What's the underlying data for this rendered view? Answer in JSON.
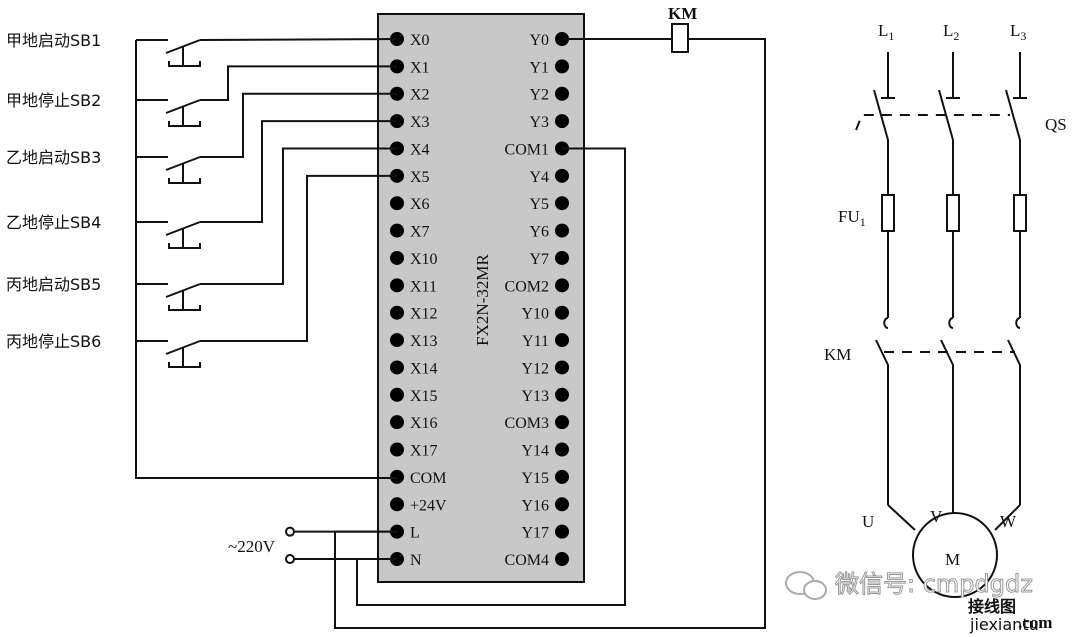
{
  "switches": [
    {
      "label": "甲地启动SB1"
    },
    {
      "label": "甲地停止SB2"
    },
    {
      "label": "乙地启动SB3"
    },
    {
      "label": "乙地停止SB4"
    },
    {
      "label": "丙地启动SB5"
    },
    {
      "label": "丙地停止SB6"
    }
  ],
  "plc": {
    "model": "FX2N-32MR",
    "body_color": "#c8c8c8",
    "left_pins": [
      "X0",
      "X1",
      "X2",
      "X3",
      "X4",
      "X5",
      "X6",
      "X7",
      "X10",
      "X11",
      "X12",
      "X13",
      "X14",
      "X15",
      "X16",
      "X17",
      "COM",
      "+24V",
      "L",
      "N"
    ],
    "right_pins": [
      "Y0",
      "Y1",
      "Y2",
      "Y3",
      "COM1",
      "Y4",
      "Y5",
      "Y6",
      "Y7",
      "COM2",
      "Y10",
      "Y11",
      "Y12",
      "Y13",
      "COM3",
      "Y14",
      "Y15",
      "Y16",
      "Y17",
      "COM4"
    ]
  },
  "coil_label": "KM",
  "supply_label": "~220V",
  "main_circuit": {
    "phases": [
      {
        "name": "L",
        "sub": "1"
      },
      {
        "name": "L",
        "sub": "2"
      },
      {
        "name": "L",
        "sub": "3"
      }
    ],
    "switch_label": "QS",
    "fuse_label": {
      "name": "FU",
      "sub": "1"
    },
    "contactor_label": "KM",
    "motor_terminals": [
      "U",
      "V",
      "W"
    ],
    "motor_label": "M"
  },
  "watermark": {
    "wechat": "微信号: cmpdgdz",
    "site_cn": "接线图",
    "site_en": "jiexiantu",
    "site_tld": ".com",
    "site_color": "#2a8a2a",
    "tld_color": "#c0392b"
  }
}
